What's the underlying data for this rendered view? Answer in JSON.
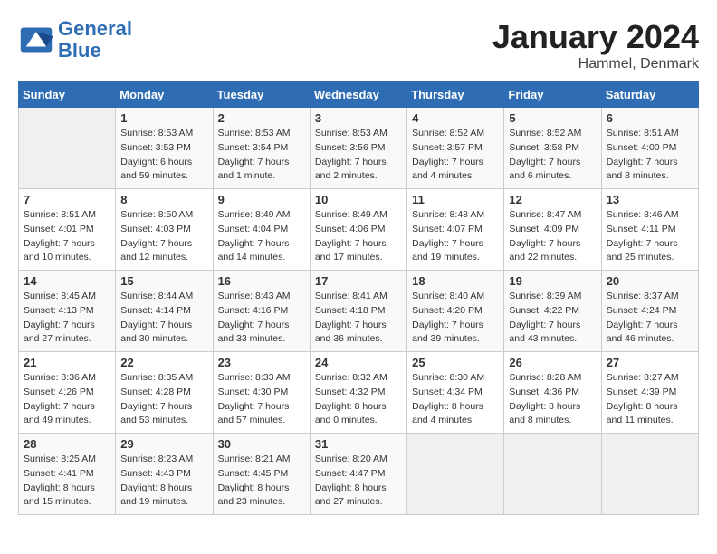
{
  "header": {
    "logo_line1": "General",
    "logo_line2": "Blue",
    "month_title": "January 2024",
    "location": "Hammel, Denmark"
  },
  "weekdays": [
    "Sunday",
    "Monday",
    "Tuesday",
    "Wednesday",
    "Thursday",
    "Friday",
    "Saturday"
  ],
  "weeks": [
    [
      {
        "day": "",
        "info": ""
      },
      {
        "day": "1",
        "info": "Sunrise: 8:53 AM\nSunset: 3:53 PM\nDaylight: 6 hours\nand 59 minutes."
      },
      {
        "day": "2",
        "info": "Sunrise: 8:53 AM\nSunset: 3:54 PM\nDaylight: 7 hours\nand 1 minute."
      },
      {
        "day": "3",
        "info": "Sunrise: 8:53 AM\nSunset: 3:56 PM\nDaylight: 7 hours\nand 2 minutes."
      },
      {
        "day": "4",
        "info": "Sunrise: 8:52 AM\nSunset: 3:57 PM\nDaylight: 7 hours\nand 4 minutes."
      },
      {
        "day": "5",
        "info": "Sunrise: 8:52 AM\nSunset: 3:58 PM\nDaylight: 7 hours\nand 6 minutes."
      },
      {
        "day": "6",
        "info": "Sunrise: 8:51 AM\nSunset: 4:00 PM\nDaylight: 7 hours\nand 8 minutes."
      }
    ],
    [
      {
        "day": "7",
        "info": "Sunrise: 8:51 AM\nSunset: 4:01 PM\nDaylight: 7 hours\nand 10 minutes."
      },
      {
        "day": "8",
        "info": "Sunrise: 8:50 AM\nSunset: 4:03 PM\nDaylight: 7 hours\nand 12 minutes."
      },
      {
        "day": "9",
        "info": "Sunrise: 8:49 AM\nSunset: 4:04 PM\nDaylight: 7 hours\nand 14 minutes."
      },
      {
        "day": "10",
        "info": "Sunrise: 8:49 AM\nSunset: 4:06 PM\nDaylight: 7 hours\nand 17 minutes."
      },
      {
        "day": "11",
        "info": "Sunrise: 8:48 AM\nSunset: 4:07 PM\nDaylight: 7 hours\nand 19 minutes."
      },
      {
        "day": "12",
        "info": "Sunrise: 8:47 AM\nSunset: 4:09 PM\nDaylight: 7 hours\nand 22 minutes."
      },
      {
        "day": "13",
        "info": "Sunrise: 8:46 AM\nSunset: 4:11 PM\nDaylight: 7 hours\nand 25 minutes."
      }
    ],
    [
      {
        "day": "14",
        "info": "Sunrise: 8:45 AM\nSunset: 4:13 PM\nDaylight: 7 hours\nand 27 minutes."
      },
      {
        "day": "15",
        "info": "Sunrise: 8:44 AM\nSunset: 4:14 PM\nDaylight: 7 hours\nand 30 minutes."
      },
      {
        "day": "16",
        "info": "Sunrise: 8:43 AM\nSunset: 4:16 PM\nDaylight: 7 hours\nand 33 minutes."
      },
      {
        "day": "17",
        "info": "Sunrise: 8:41 AM\nSunset: 4:18 PM\nDaylight: 7 hours\nand 36 minutes."
      },
      {
        "day": "18",
        "info": "Sunrise: 8:40 AM\nSunset: 4:20 PM\nDaylight: 7 hours\nand 39 minutes."
      },
      {
        "day": "19",
        "info": "Sunrise: 8:39 AM\nSunset: 4:22 PM\nDaylight: 7 hours\nand 43 minutes."
      },
      {
        "day": "20",
        "info": "Sunrise: 8:37 AM\nSunset: 4:24 PM\nDaylight: 7 hours\nand 46 minutes."
      }
    ],
    [
      {
        "day": "21",
        "info": "Sunrise: 8:36 AM\nSunset: 4:26 PM\nDaylight: 7 hours\nand 49 minutes."
      },
      {
        "day": "22",
        "info": "Sunrise: 8:35 AM\nSunset: 4:28 PM\nDaylight: 7 hours\nand 53 minutes."
      },
      {
        "day": "23",
        "info": "Sunrise: 8:33 AM\nSunset: 4:30 PM\nDaylight: 7 hours\nand 57 minutes."
      },
      {
        "day": "24",
        "info": "Sunrise: 8:32 AM\nSunset: 4:32 PM\nDaylight: 8 hours\nand 0 minutes."
      },
      {
        "day": "25",
        "info": "Sunrise: 8:30 AM\nSunset: 4:34 PM\nDaylight: 8 hours\nand 4 minutes."
      },
      {
        "day": "26",
        "info": "Sunrise: 8:28 AM\nSunset: 4:36 PM\nDaylight: 8 hours\nand 8 minutes."
      },
      {
        "day": "27",
        "info": "Sunrise: 8:27 AM\nSunset: 4:39 PM\nDaylight: 8 hours\nand 11 minutes."
      }
    ],
    [
      {
        "day": "28",
        "info": "Sunrise: 8:25 AM\nSunset: 4:41 PM\nDaylight: 8 hours\nand 15 minutes."
      },
      {
        "day": "29",
        "info": "Sunrise: 8:23 AM\nSunset: 4:43 PM\nDaylight: 8 hours\nand 19 minutes."
      },
      {
        "day": "30",
        "info": "Sunrise: 8:21 AM\nSunset: 4:45 PM\nDaylight: 8 hours\nand 23 minutes."
      },
      {
        "day": "31",
        "info": "Sunrise: 8:20 AM\nSunset: 4:47 PM\nDaylight: 8 hours\nand 27 minutes."
      },
      {
        "day": "",
        "info": ""
      },
      {
        "day": "",
        "info": ""
      },
      {
        "day": "",
        "info": ""
      }
    ]
  ]
}
